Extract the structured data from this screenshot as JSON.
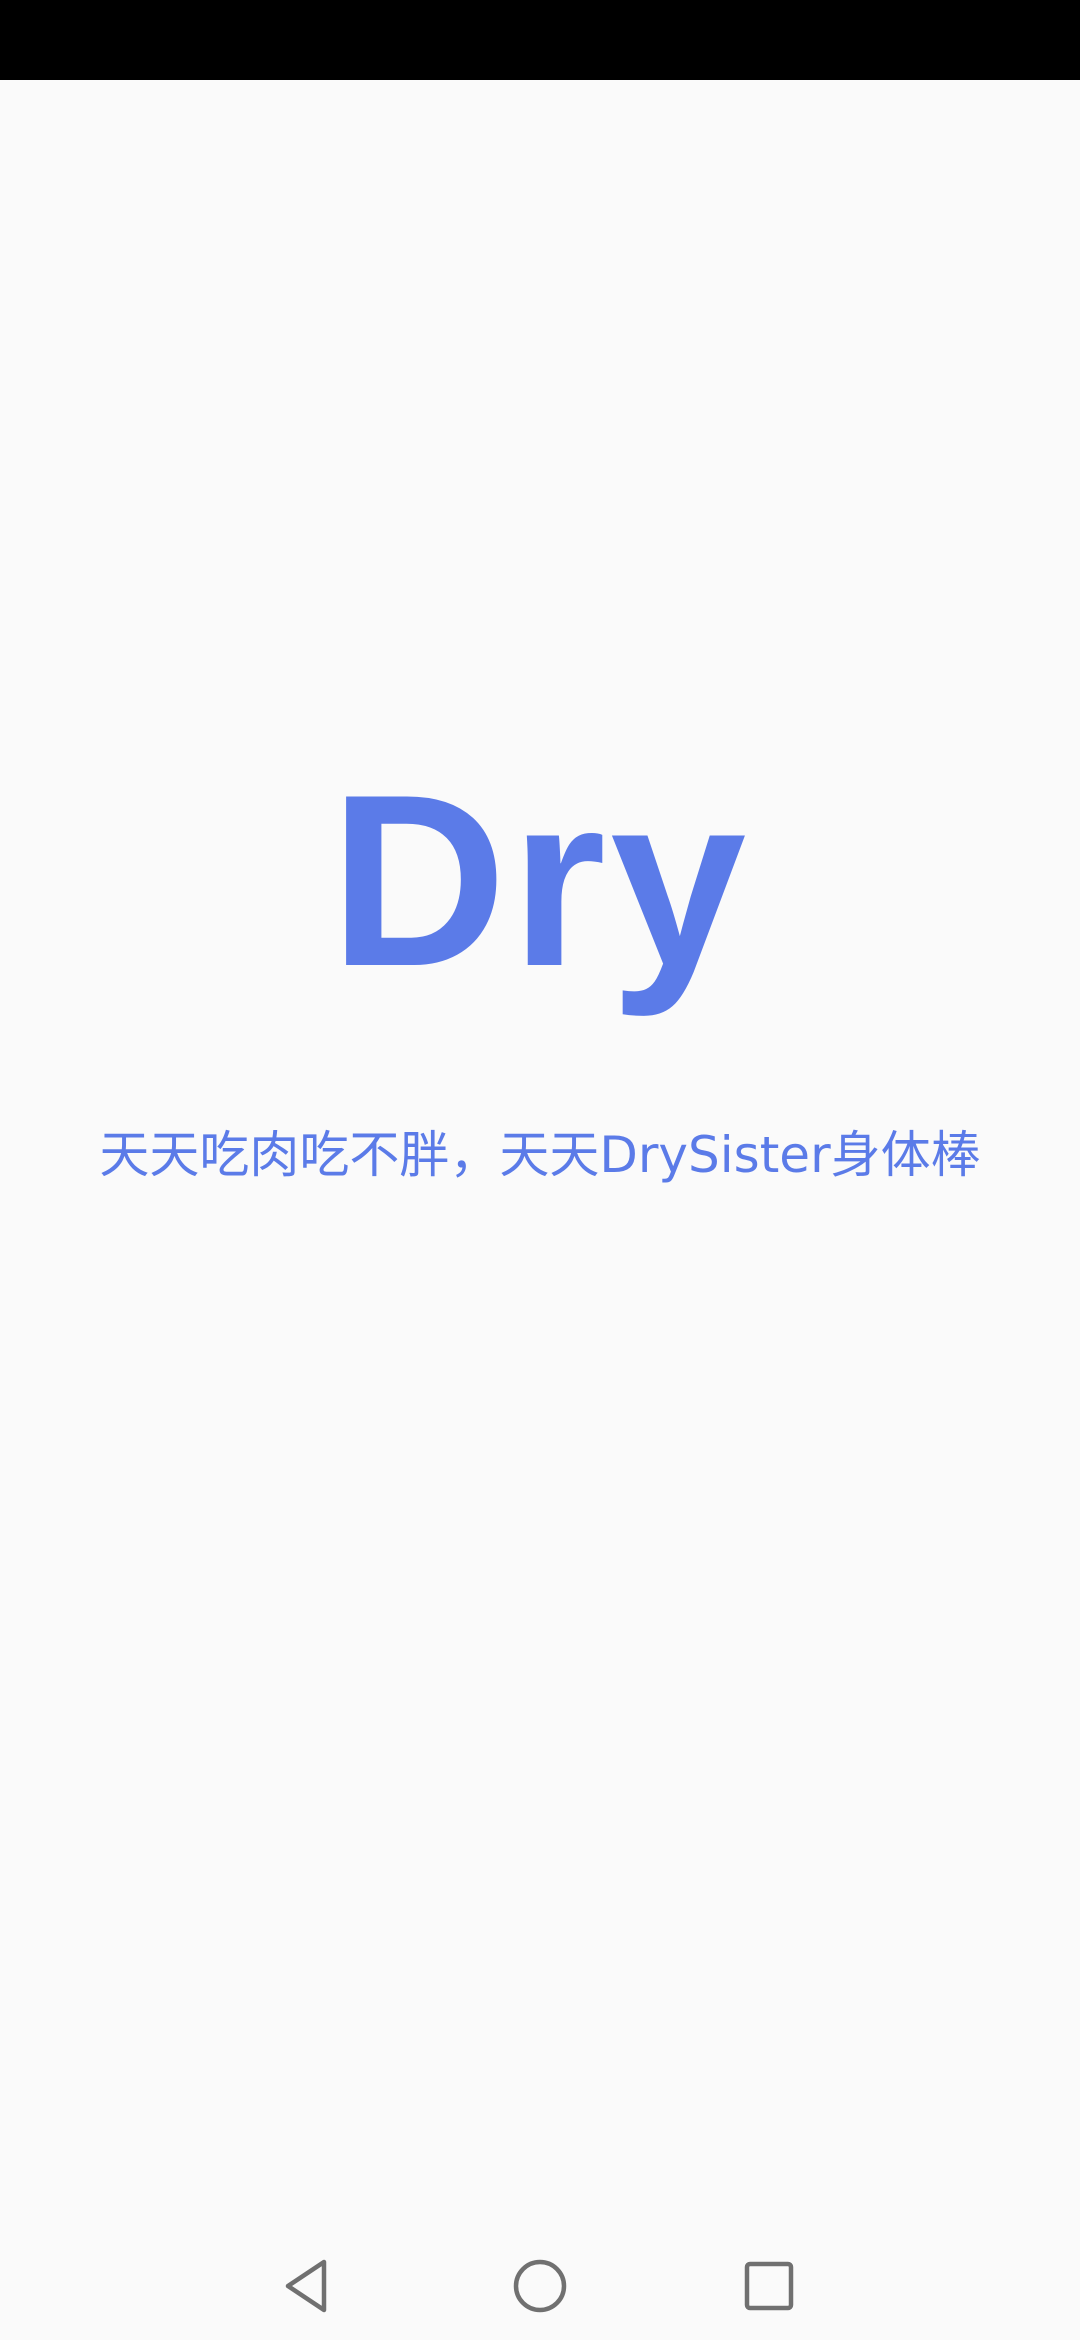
{
  "app": {
    "logo_text": "Dry",
    "slogan": "天天吃肉吃不胖，天天DrySister身体棒"
  },
  "theme": {
    "accent": "#5b7be8",
    "background": "#fafafa",
    "status_bar": "#000000",
    "nav_icon": "#707070"
  },
  "nav": {
    "back_icon": "back-triangle-icon",
    "home_icon": "home-circle-icon",
    "recent_icon": "recent-apps-square-icon"
  }
}
